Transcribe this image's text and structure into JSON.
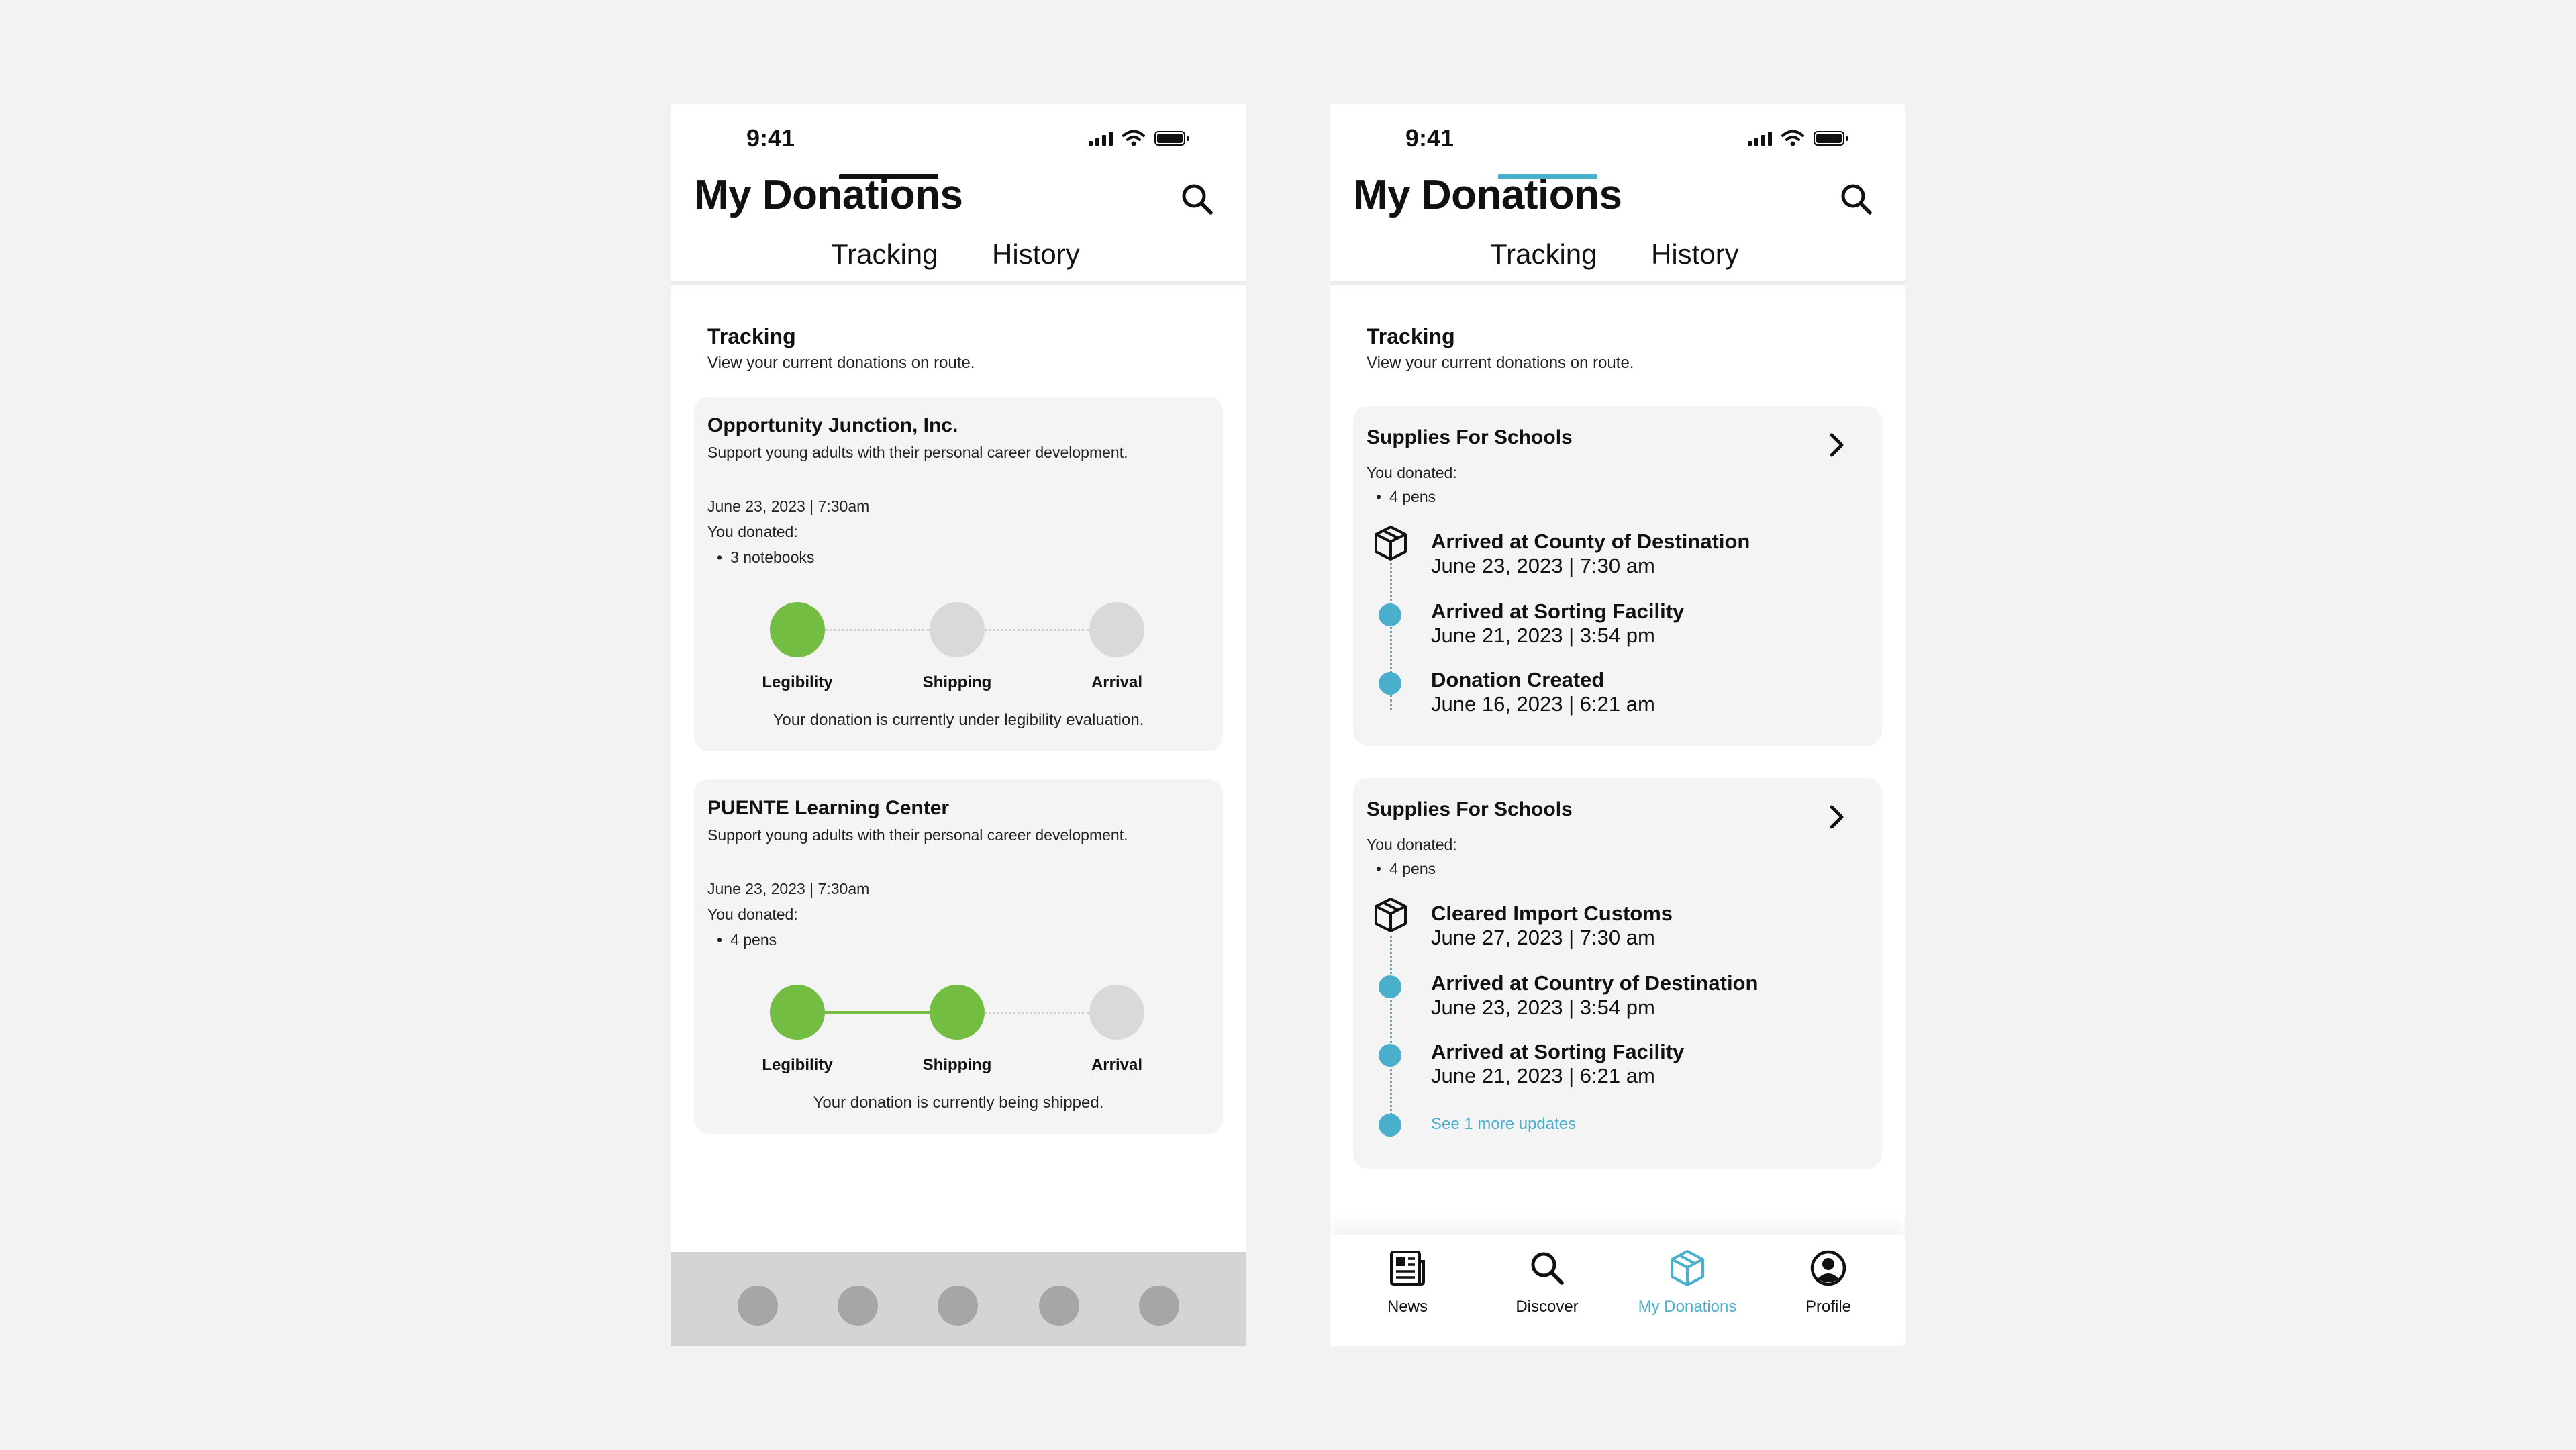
{
  "colors": {
    "green": "#74bd43",
    "gray_step": "#d9d9d9",
    "accent": "#4aafcc",
    "black": "#111111"
  },
  "status": {
    "time": "9:41"
  },
  "screens": [
    {
      "title": "My Donations",
      "tabs": [
        "Tracking",
        "History"
      ],
      "active_tab": "Tracking",
      "section": {
        "title": "Tracking",
        "subtitle": "View your current donations on route."
      },
      "cards": [
        {
          "title": "Opportunity Junction, Inc.",
          "description": "Support young adults with their personal career development.",
          "datetime": "June 23, 2023 | 7:30am",
          "donated_label": "You donated:",
          "items": [
            "3 notebooks"
          ],
          "steps": [
            {
              "label": "Legibility",
              "done": true
            },
            {
              "label": "Shipping",
              "done": false
            },
            {
              "label": "Arrival",
              "done": false
            }
          ],
          "status": "Your donation is currently under legibility evaluation."
        },
        {
          "title": "PUENTE Learning Center",
          "description": "Support young adults with their personal career development.",
          "datetime": "June 23, 2023 | 7:30am",
          "donated_label": "You donated:",
          "items": [
            "4 pens"
          ],
          "steps": [
            {
              "label": "Legibility",
              "done": true
            },
            {
              "label": "Shipping",
              "done": true
            },
            {
              "label": "Arrival",
              "done": false
            }
          ],
          "status": "Your donation is currently being shipped."
        }
      ]
    },
    {
      "title": "My Donations",
      "tabs": [
        "Tracking",
        "History"
      ],
      "active_tab": "Tracking",
      "section": {
        "title": "Tracking",
        "subtitle": "View your current donations on route."
      },
      "cards": [
        {
          "title": "Supplies For Schools",
          "donated_label": "You donated:",
          "items": [
            "4 pens"
          ],
          "updates": [
            {
              "event": "Arrived at County of Destination",
              "date": "June 23, 2023 | 7:30 am",
              "icon": "package-icon"
            },
            {
              "event": "Arrived at Sorting Facility",
              "date": "June 21, 2023 | 3:54 pm",
              "icon": "dot"
            },
            {
              "event": "Donation Created",
              "date": "June 16, 2023 | 6:21 am",
              "icon": "dot"
            }
          ]
        },
        {
          "title": "Supplies For Schools",
          "donated_label": "You donated:",
          "items": [
            "4 pens"
          ],
          "updates": [
            {
              "event": "Cleared Import Customs",
              "date": "June 27, 2023 | 7:30 am",
              "icon": "package-icon"
            },
            {
              "event": "Arrived at Country of Destination",
              "date": "June 23, 2023 | 3:54 pm",
              "icon": "dot"
            },
            {
              "event": "Arrived at Sorting Facility",
              "date": "June 21, 2023 | 6:21 am",
              "icon": "dot"
            }
          ],
          "more_link": "See 1 more updates"
        }
      ],
      "nav": [
        {
          "label": "News",
          "icon": "newspaper-icon",
          "active": false
        },
        {
          "label": "Discover",
          "icon": "search-icon",
          "active": false
        },
        {
          "label": "My Donations",
          "icon": "package-icon",
          "active": true
        },
        {
          "label": "Profile",
          "icon": "profile-icon",
          "active": false
        }
      ]
    }
  ]
}
